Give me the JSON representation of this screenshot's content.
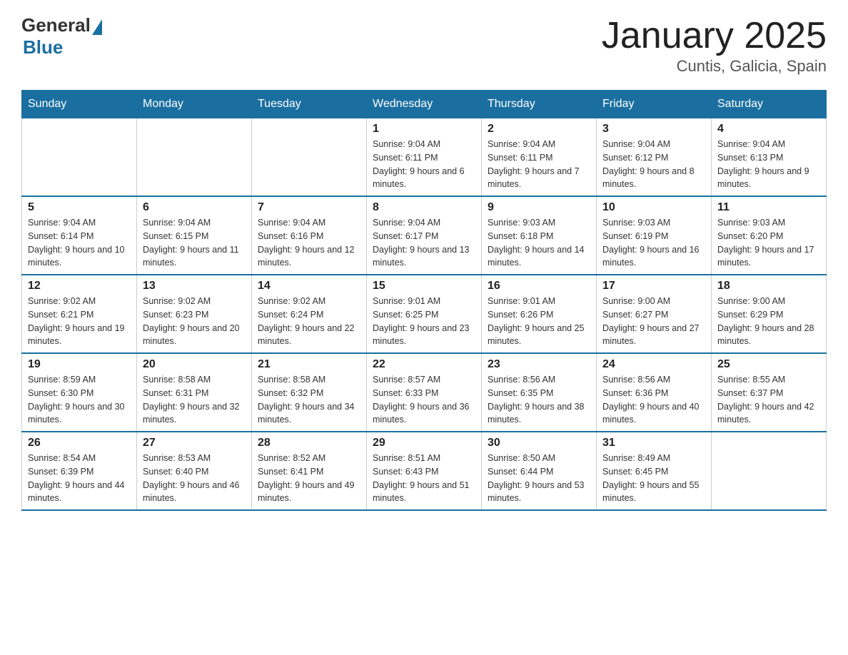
{
  "header": {
    "logo_general": "General",
    "logo_blue": "Blue",
    "title": "January 2025",
    "subtitle": "Cuntis, Galicia, Spain"
  },
  "days_of_week": [
    "Sunday",
    "Monday",
    "Tuesday",
    "Wednesday",
    "Thursday",
    "Friday",
    "Saturday"
  ],
  "weeks": [
    [
      {
        "day": "",
        "info": ""
      },
      {
        "day": "",
        "info": ""
      },
      {
        "day": "",
        "info": ""
      },
      {
        "day": "1",
        "info": "Sunrise: 9:04 AM\nSunset: 6:11 PM\nDaylight: 9 hours and 6 minutes."
      },
      {
        "day": "2",
        "info": "Sunrise: 9:04 AM\nSunset: 6:11 PM\nDaylight: 9 hours and 7 minutes."
      },
      {
        "day": "3",
        "info": "Sunrise: 9:04 AM\nSunset: 6:12 PM\nDaylight: 9 hours and 8 minutes."
      },
      {
        "day": "4",
        "info": "Sunrise: 9:04 AM\nSunset: 6:13 PM\nDaylight: 9 hours and 9 minutes."
      }
    ],
    [
      {
        "day": "5",
        "info": "Sunrise: 9:04 AM\nSunset: 6:14 PM\nDaylight: 9 hours and 10 minutes."
      },
      {
        "day": "6",
        "info": "Sunrise: 9:04 AM\nSunset: 6:15 PM\nDaylight: 9 hours and 11 minutes."
      },
      {
        "day": "7",
        "info": "Sunrise: 9:04 AM\nSunset: 6:16 PM\nDaylight: 9 hours and 12 minutes."
      },
      {
        "day": "8",
        "info": "Sunrise: 9:04 AM\nSunset: 6:17 PM\nDaylight: 9 hours and 13 minutes."
      },
      {
        "day": "9",
        "info": "Sunrise: 9:03 AM\nSunset: 6:18 PM\nDaylight: 9 hours and 14 minutes."
      },
      {
        "day": "10",
        "info": "Sunrise: 9:03 AM\nSunset: 6:19 PM\nDaylight: 9 hours and 16 minutes."
      },
      {
        "day": "11",
        "info": "Sunrise: 9:03 AM\nSunset: 6:20 PM\nDaylight: 9 hours and 17 minutes."
      }
    ],
    [
      {
        "day": "12",
        "info": "Sunrise: 9:02 AM\nSunset: 6:21 PM\nDaylight: 9 hours and 19 minutes."
      },
      {
        "day": "13",
        "info": "Sunrise: 9:02 AM\nSunset: 6:23 PM\nDaylight: 9 hours and 20 minutes."
      },
      {
        "day": "14",
        "info": "Sunrise: 9:02 AM\nSunset: 6:24 PM\nDaylight: 9 hours and 22 minutes."
      },
      {
        "day": "15",
        "info": "Sunrise: 9:01 AM\nSunset: 6:25 PM\nDaylight: 9 hours and 23 minutes."
      },
      {
        "day": "16",
        "info": "Sunrise: 9:01 AM\nSunset: 6:26 PM\nDaylight: 9 hours and 25 minutes."
      },
      {
        "day": "17",
        "info": "Sunrise: 9:00 AM\nSunset: 6:27 PM\nDaylight: 9 hours and 27 minutes."
      },
      {
        "day": "18",
        "info": "Sunrise: 9:00 AM\nSunset: 6:29 PM\nDaylight: 9 hours and 28 minutes."
      }
    ],
    [
      {
        "day": "19",
        "info": "Sunrise: 8:59 AM\nSunset: 6:30 PM\nDaylight: 9 hours and 30 minutes."
      },
      {
        "day": "20",
        "info": "Sunrise: 8:58 AM\nSunset: 6:31 PM\nDaylight: 9 hours and 32 minutes."
      },
      {
        "day": "21",
        "info": "Sunrise: 8:58 AM\nSunset: 6:32 PM\nDaylight: 9 hours and 34 minutes."
      },
      {
        "day": "22",
        "info": "Sunrise: 8:57 AM\nSunset: 6:33 PM\nDaylight: 9 hours and 36 minutes."
      },
      {
        "day": "23",
        "info": "Sunrise: 8:56 AM\nSunset: 6:35 PM\nDaylight: 9 hours and 38 minutes."
      },
      {
        "day": "24",
        "info": "Sunrise: 8:56 AM\nSunset: 6:36 PM\nDaylight: 9 hours and 40 minutes."
      },
      {
        "day": "25",
        "info": "Sunrise: 8:55 AM\nSunset: 6:37 PM\nDaylight: 9 hours and 42 minutes."
      }
    ],
    [
      {
        "day": "26",
        "info": "Sunrise: 8:54 AM\nSunset: 6:39 PM\nDaylight: 9 hours and 44 minutes."
      },
      {
        "day": "27",
        "info": "Sunrise: 8:53 AM\nSunset: 6:40 PM\nDaylight: 9 hours and 46 minutes."
      },
      {
        "day": "28",
        "info": "Sunrise: 8:52 AM\nSunset: 6:41 PM\nDaylight: 9 hours and 49 minutes."
      },
      {
        "day": "29",
        "info": "Sunrise: 8:51 AM\nSunset: 6:43 PM\nDaylight: 9 hours and 51 minutes."
      },
      {
        "day": "30",
        "info": "Sunrise: 8:50 AM\nSunset: 6:44 PM\nDaylight: 9 hours and 53 minutes."
      },
      {
        "day": "31",
        "info": "Sunrise: 8:49 AM\nSunset: 6:45 PM\nDaylight: 9 hours and 55 minutes."
      },
      {
        "day": "",
        "info": ""
      }
    ]
  ]
}
